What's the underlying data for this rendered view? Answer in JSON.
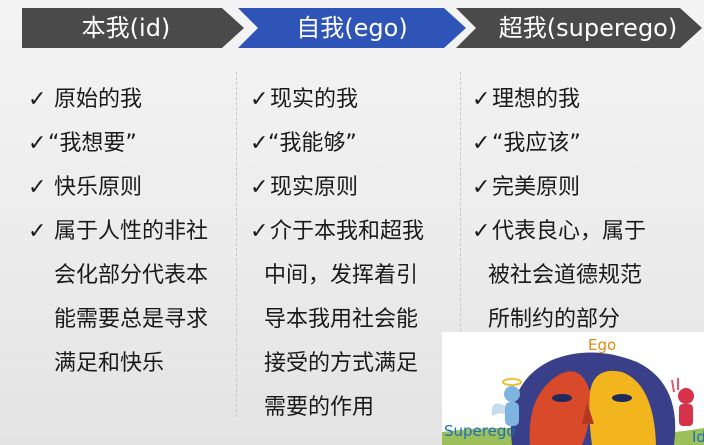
{
  "tabs": [
    {
      "label": "本我(id)",
      "color": "#4a4a4a"
    },
    {
      "label": "自我(ego)",
      "color": "#2f54b8"
    },
    {
      "label": "超我(superego)",
      "color": "#4a4a4a"
    }
  ],
  "check_glyph": "✓",
  "columns": [
    {
      "items": [
        {
          "lines": [
            "原始的我"
          ]
        },
        {
          "lines": [
            "“我想要”"
          ]
        },
        {
          "lines": [
            "快乐原则"
          ]
        },
        {
          "lines": [
            "属于人性的非社",
            "会化部分代表本",
            "能需要总是寻求",
            "满足和快乐"
          ]
        }
      ]
    },
    {
      "items": [
        {
          "lines": [
            "现实的我"
          ]
        },
        {
          "lines": [
            "“我能够”"
          ]
        },
        {
          "lines": [
            "现实原则"
          ]
        },
        {
          "lines": [
            "介于本我和超我",
            "中间，发挥着引",
            "导本我用社会能",
            "接受的方式满足",
            "需要的作用"
          ]
        }
      ]
    },
    {
      "items": [
        {
          "lines": [
            "理想的我"
          ]
        },
        {
          "lines": [
            "“我应该”"
          ]
        },
        {
          "lines": [
            "完美原则"
          ]
        },
        {
          "lines": [
            "代表良心，属于",
            "被社会道德规范",
            "所制约的部分"
          ]
        }
      ]
    }
  ],
  "illustration": {
    "ego_label": "Ego",
    "superego_label": "Superego",
    "id_label": "Id"
  }
}
